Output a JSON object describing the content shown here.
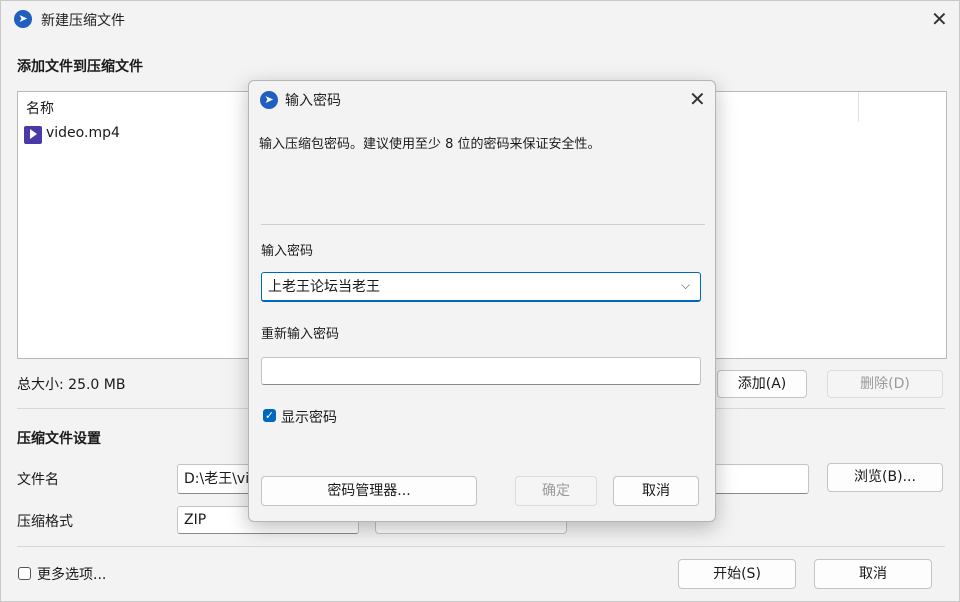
{
  "window": {
    "title": "新建压缩文件",
    "add_section_title": "添加文件到压缩文件",
    "file_list": {
      "column_header": "名称",
      "items": [
        {
          "name": "video.mp4",
          "icon": "video-file-icon"
        }
      ]
    },
    "total_size": "总大小: 25.0 MB",
    "add_button": "添加(A)",
    "delete_button": "删除(D)",
    "settings_title": "压缩文件设置",
    "filename_label": "文件名",
    "filename_value": "D:\\老王\\vi",
    "browse_button": "浏览(B)...",
    "format_label": "压缩格式",
    "format_value": "ZIP",
    "more_options_label": "更多选项...",
    "start_button": "开始(S)",
    "cancel_button": "取消"
  },
  "dialog": {
    "title": "输入密码",
    "description": "输入压缩包密码。建议使用至少 8 位的密码来保证安全性。",
    "password_label": "输入密码",
    "password_value": "上老王论坛当老王",
    "reenter_label": "重新输入密码",
    "reenter_value": "",
    "show_password_label": "显示密码",
    "show_password_checked": true,
    "manager_button": "密码管理器...",
    "ok_button": "确定",
    "cancel_button": "取消"
  },
  "icons": {
    "app": "app-logo-icon",
    "close": "close-icon",
    "dropdown": "chevron-down-icon"
  },
  "colors": {
    "accent": "#0067c0",
    "app_icon": "#1f5fbf"
  }
}
